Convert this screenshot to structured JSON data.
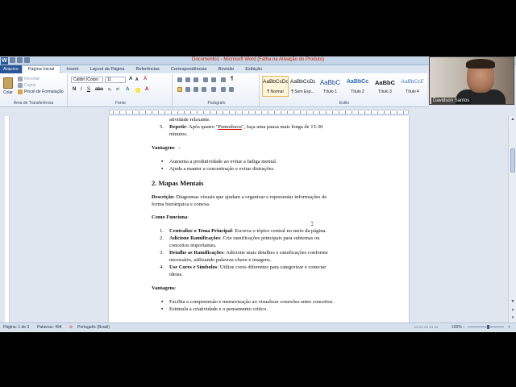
{
  "window": {
    "title": "Documento1 - Microsoft Word (Falha na Ativação do Produto)",
    "logo_letter": "W"
  },
  "tabs": [
    "Arquivo",
    "Página Inicial",
    "Inserir",
    "Layout da Página",
    "Referências",
    "Correspondências",
    "Revisão",
    "Exibição"
  ],
  "ribbon": {
    "clipboard": {
      "paste_label": "Colar",
      "cut_label": "Recortar",
      "copy_label": "Copiar",
      "format_painter_label": "Pincel de Formatação",
      "group_label": "Área de Transferência"
    },
    "font": {
      "font_name": "Calibri (Corpo",
      "font_size": "11",
      "group_label": "Fonte"
    },
    "paragraph": {
      "group_label": "Parágrafo"
    },
    "styles": {
      "group_label": "Estilo",
      "items": [
        {
          "sample": "AaBbCcDc",
          "name": "¶ Normal"
        },
        {
          "sample": "AaBbCcDc",
          "name": "¶ Sem Esp..."
        },
        {
          "sample": "AaBbC",
          "name": "Título 1"
        },
        {
          "sample": "AaBbCc",
          "name": "Título 2"
        },
        {
          "sample": "AaBbC",
          "name": "Título 3"
        },
        {
          "sample": "AaBbCcE",
          "name": "Título 4"
        }
      ]
    }
  },
  "document": {
    "lines": {
      "l1": "atividade relaxante.",
      "l2_num": "5.",
      "l2_bold": "Repetir",
      "l2_a": ": Após quatro \"",
      "l2_u": "Pomodoros",
      "l2_b": "\", faça uma pausa mais longa de 15-30",
      "l3": "minutos.",
      "vantagens1": "Vantagens",
      "b1": "Aumenta a produtividade ao evitar a fadiga mental.",
      "b2": "Ajuda a manter a concentração e evitar distrações.",
      "heading": "2. Mapas Mentais",
      "desc_bold": "Descrição",
      "desc_a": ": Diagramas visuais que ajudam a organizar e representar informações de",
      "desc_b": "forma hierárquica e conexa.",
      "como": "Como Funciona",
      "n1_num": "1.",
      "n1_bold": "Centralize o Tema Principal",
      "n1_text": ": Escreva o tópico central no meio da página.",
      "n2_num": "2.",
      "n2_bold": "Adicione Ramificações",
      "n2_text": ": Crie ramificações principais para subtemas ou",
      "n2_cont": "conceitos importantes.",
      "n3_num": "3.",
      "n3_bold": "Detalhe as Ramificações",
      "n3_text": ": Adicione mais detalhes e ramificações conforme",
      "n3_cont": "necessário, utilizando palavras-chave e imagens.",
      "n4_num": "4.",
      "n4_bold": "Use Cores e Símbolos",
      "n4_text": ": Utilize cores diferentes para categorizar e conectar",
      "n4_cont": "ideias.",
      "vantagens2": "Vantagens",
      "b3": "Facilita a compreensão e memorização ao visualizar conexões entre conceitos.",
      "b4": "Estimula a criatividade e o pensamento crítico."
    }
  },
  "status": {
    "page": "Página: 1 de 3",
    "words": "Palavras: 494",
    "language": "Português (Brasil)",
    "zoom": "100%"
  },
  "webcam": {
    "name": "Davidson Santos"
  },
  "colors": {
    "file_tab": "#2a5699",
    "title_text": "#cc2200",
    "ribbon_bg": "#dfe6ef"
  }
}
